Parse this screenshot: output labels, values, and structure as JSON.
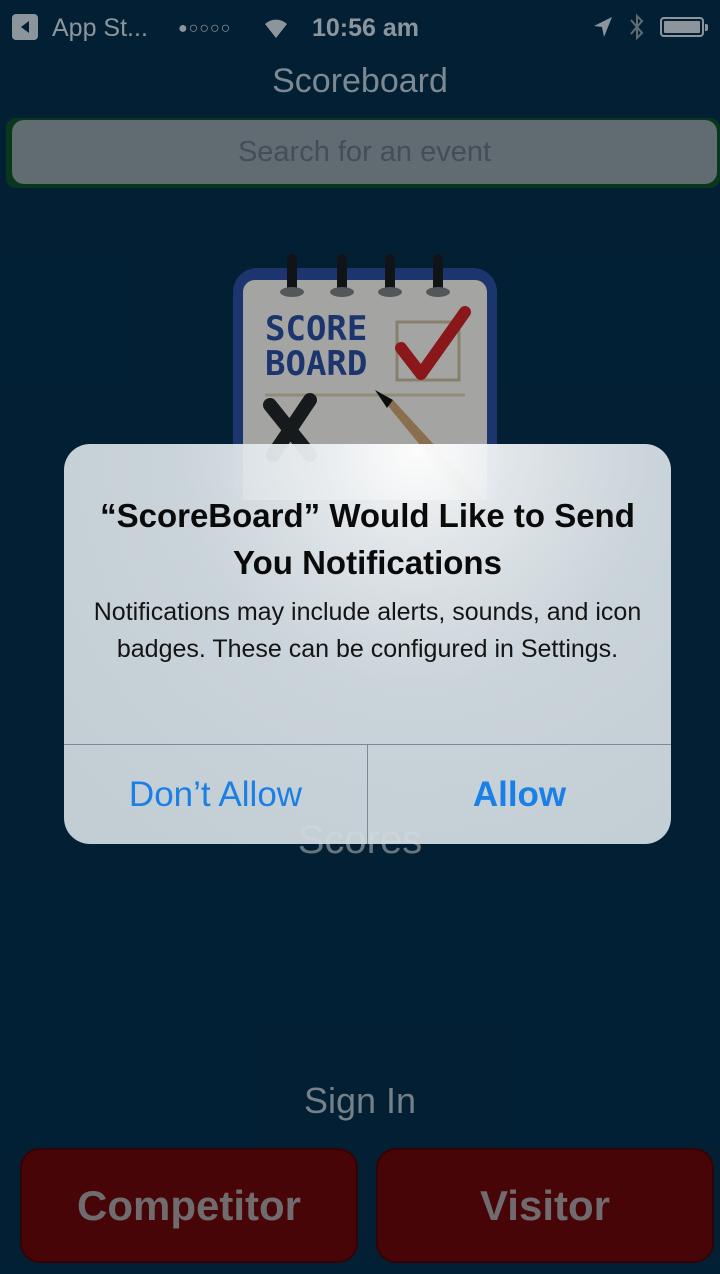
{
  "status_bar": {
    "back_app": "App St...",
    "signal_dots": "●○○○○",
    "time": "10:56 am"
  },
  "nav": {
    "title": "Scoreboard"
  },
  "search": {
    "placeholder": "Search for an event"
  },
  "logo": {
    "line1": "SCORE",
    "line2": "BOARD"
  },
  "background": {
    "partial_text": "Scores"
  },
  "sign_in": {
    "label": "Sign In"
  },
  "buttons": {
    "competitor": "Competitor",
    "visitor": "Visitor"
  },
  "alert": {
    "title": "“ScoreBoard” Would Like to Send You Notifications",
    "message": "Notifications may include alerts, sounds, and icon badges. These can be configured in Settings.",
    "deny_label": "Don’t Allow",
    "allow_label": "Allow"
  },
  "colors": {
    "background": "#032a45",
    "button_red": "#6a0303",
    "ios_blue": "#1a7fe6",
    "logo_blue": "#2b4a9a",
    "check_red": "#cc1f1f"
  }
}
